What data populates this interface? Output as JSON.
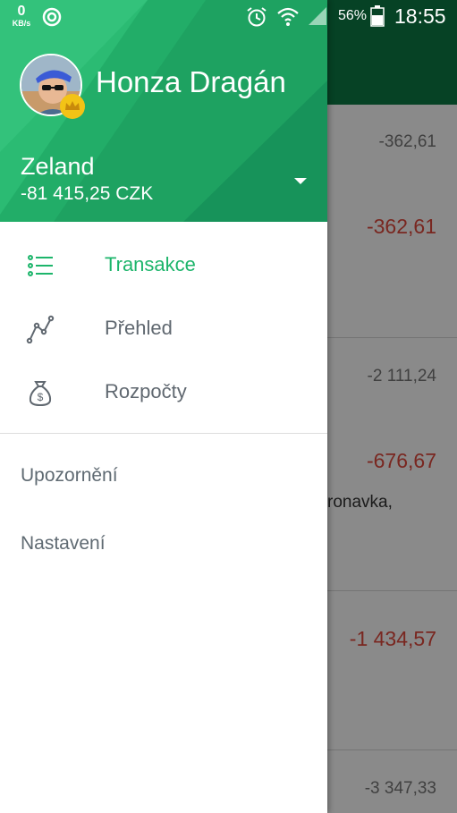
{
  "status_bar": {
    "network_speed": "0",
    "network_unit": "KB/s",
    "battery_percent": "56%",
    "time": "18:55",
    "icons": [
      "sync-icon",
      "alarm-icon",
      "wifi-icon",
      "signal-icon",
      "battery-icon"
    ]
  },
  "drawer": {
    "user_name": "Honza Dragán",
    "account_name": "Zeland",
    "account_balance": "-81 415,25 CZK",
    "menu": [
      {
        "label": "Transakce",
        "icon": "list-icon",
        "active": true
      },
      {
        "label": "Přehled",
        "icon": "chart-line-icon",
        "active": false
      },
      {
        "label": "Rozpočty",
        "icon": "money-bag-icon",
        "active": false
      }
    ],
    "secondary": [
      {
        "label": "Upozornění"
      },
      {
        "label": "Nastavení"
      }
    ]
  },
  "background_list": {
    "amounts": [
      "-362,61",
      "-362,61",
      "-2 111,24",
      "-676,67",
      "-1 434,57",
      "-3 347,33"
    ],
    "partial_text": "ronavka,"
  },
  "colors": {
    "header_green": "#2bbb73",
    "toolbar_dark_green": "#0c7a45",
    "active_green": "#1db56b",
    "expense_red": "#e0483c"
  }
}
